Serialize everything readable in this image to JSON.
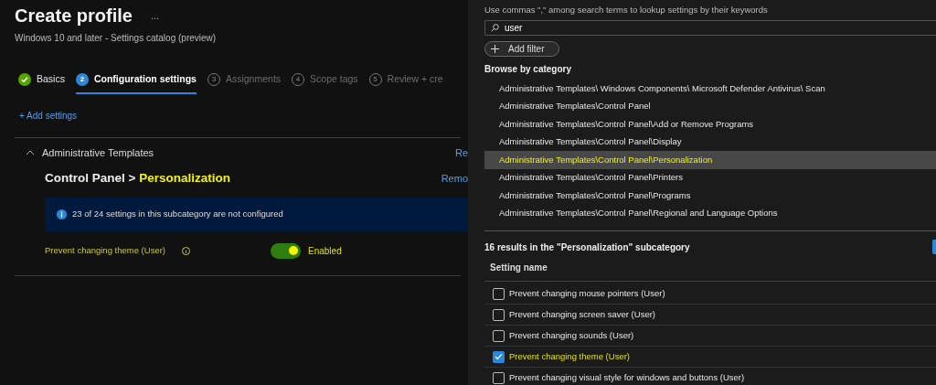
{
  "page": {
    "title": "Create profile",
    "more": "...",
    "subtitle": "Windows 10 and later - Settings catalog (preview)"
  },
  "steps": [
    {
      "label": "Basics",
      "done": true,
      "selected": false
    },
    {
      "number": "2",
      "label": "Configuration settings",
      "done": false,
      "selected": true
    },
    {
      "number": "3",
      "label": "Assignments",
      "done": false,
      "selected": false
    },
    {
      "number": "4",
      "label": "Scope tags",
      "done": false,
      "selected": false
    },
    {
      "number": "5",
      "label": "Review + cre",
      "done": false,
      "selected": false
    }
  ],
  "add_settings": "+ Add settings",
  "section": {
    "title": "Administrative Templates",
    "expanded": true,
    "action": "Re",
    "heading": "Control Panel >",
    "heading_highlight": "Personalization",
    "heading_action": "Remo",
    "info": "23 of 24 settings in this subcategory are not configured",
    "setting": {
      "label": "Prevent changing theme (User)",
      "on": true,
      "value": "Enabled"
    }
  },
  "picker": {
    "hint": "Use commas \",\" among search terms to lookup settings by their keywords",
    "search": "user",
    "add_filter": "Add filter",
    "browse_title": "Browse by category",
    "categories": [
      {
        "label": "Administrative Templates\\ Windows Components\\ Microsoft Defender Antivirus\\ Scan",
        "selected": false
      },
      {
        "label": "Administrative Templates\\Control Panel",
        "selected": false
      },
      {
        "label": "Administrative Templates\\Control Panel\\Add or Remove Programs",
        "selected": false
      },
      {
        "label": "Administrative Templates\\Control Panel\\Display",
        "selected": false
      },
      {
        "label": "Administrative Templates\\Control Panel\\Personalization",
        "selected": true
      },
      {
        "label": "Administrative Templates\\Control Panel\\Printers",
        "selected": false
      },
      {
        "label": "Administrative Templates\\Control Panel\\Programs",
        "selected": false
      },
      {
        "label": "Administrative Templates\\Control Panel\\Regional and Language Options",
        "selected": false
      }
    ],
    "results_title": "16 results in the \"Personalization\" subcategory",
    "column": "Setting name",
    "settings": [
      {
        "label": "Prevent changing mouse pointers (User)",
        "checked": false
      },
      {
        "label": "Prevent changing screen saver (User)",
        "checked": false
      },
      {
        "label": "Prevent changing sounds (User)",
        "checked": false
      },
      {
        "label": "Prevent changing theme (User)",
        "checked": true
      },
      {
        "label": "Prevent changing visual style for windows and buttons (User)",
        "checked": false
      }
    ]
  }
}
